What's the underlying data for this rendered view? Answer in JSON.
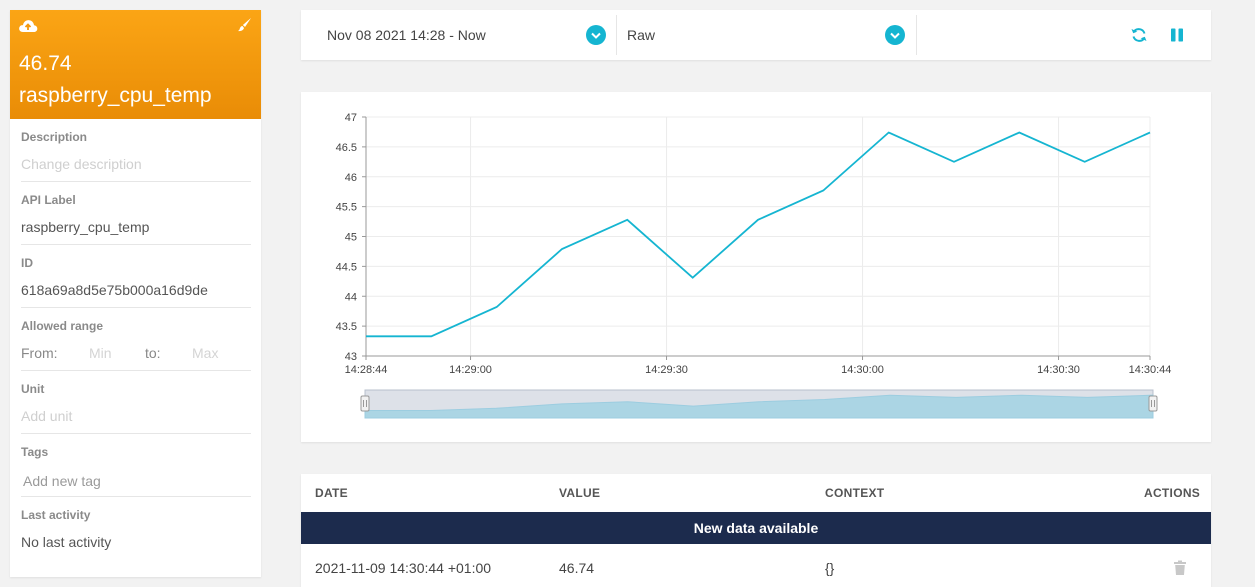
{
  "variable": {
    "last_value": "46.74",
    "name": "raspberry_cpu_temp",
    "header_color": "#f59b0c"
  },
  "properties": {
    "description": {
      "label": "Description",
      "placeholder": "Change description"
    },
    "api_label": {
      "label": "API Label",
      "value": "raspberry_cpu_temp"
    },
    "id": {
      "label": "ID",
      "value": "618a69a8d5e75b000a16d9de"
    },
    "allowed_range": {
      "label": "Allowed range",
      "from_label": "From:",
      "from_placeholder": "Min",
      "to_label": "to:",
      "to_placeholder": "Max"
    },
    "unit": {
      "label": "Unit",
      "placeholder": "Add unit"
    },
    "tags": {
      "label": "Tags",
      "placeholder": "Add new tag"
    },
    "last_activity": {
      "label": "Last activity",
      "value": "No last activity"
    }
  },
  "toolbar": {
    "date_range": "Nov 08 2021 14:28 - Now",
    "aggregation": "Raw",
    "accent": "#15b5d1",
    "icons": [
      "refresh-icon",
      "pause-icon"
    ]
  },
  "chart_data": {
    "type": "line",
    "title": "",
    "xlabel": "",
    "ylabel": "",
    "x": [
      "14:28:44",
      "14:28:54",
      "14:29:04",
      "14:29:14",
      "14:29:24",
      "14:29:34",
      "14:29:44",
      "14:29:54",
      "14:30:04",
      "14:30:14",
      "14:30:24",
      "14:30:34",
      "14:30:44"
    ],
    "series": [
      {
        "values": [
          43.33,
          43.33,
          43.82,
          44.79,
          45.28,
          44.31,
          45.28,
          45.77,
          46.74,
          46.25,
          46.74,
          46.25,
          46.74
        ],
        "color": "#15b5d1"
      }
    ],
    "ylim": [
      43,
      47
    ],
    "yticks": [
      "47",
      "46.5",
      "46",
      "45.5",
      "45",
      "44.5",
      "44",
      "43.5",
      "43"
    ],
    "xticks": [
      "14:28:44",
      "14:29:00",
      "14:29:30",
      "14:30:00",
      "14:30:30",
      "14:30:44"
    ],
    "grid": true,
    "has_range_navigator": true
  },
  "table": {
    "columns": [
      "DATE",
      "VALUE",
      "CONTEXT",
      "ACTIONS"
    ],
    "banner": "New data available",
    "rows": [
      {
        "date": "2021-11-09 14:30:44 +01:00",
        "value": "46.74",
        "context": "{}"
      }
    ]
  }
}
